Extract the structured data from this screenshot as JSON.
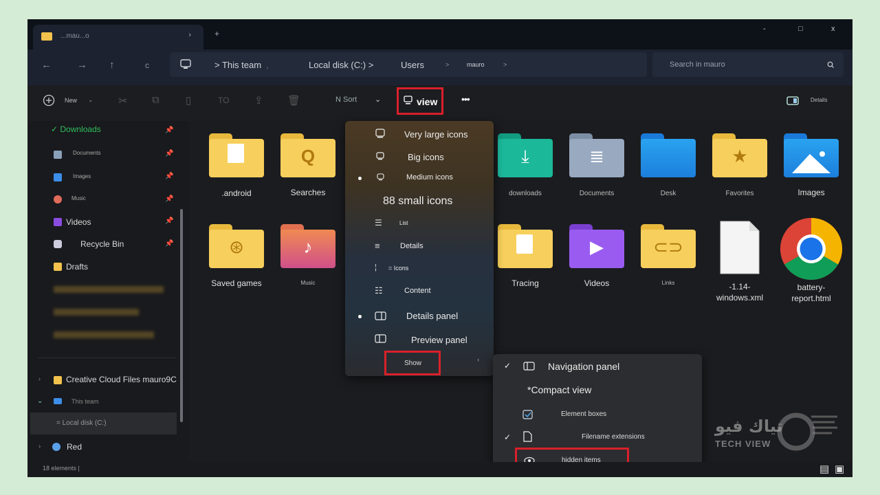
{
  "window": {
    "tab_title": "...mau...o",
    "new_tab": "+",
    "minimize": "-",
    "maximize": "□",
    "close": "x"
  },
  "nav": {
    "back": "←",
    "forward": "→",
    "up": "↑",
    "refresh": "c"
  },
  "address": {
    "crumbs": [
      "> This team",
      "Local disk (C:) >",
      "Users",
      "mauro"
    ],
    "separators": [
      ",",
      ">",
      ">"
    ]
  },
  "search": {
    "placeholder": "Search in mauro"
  },
  "toolbar": {
    "new_label": "New",
    "sort_label": "N Sort",
    "view_label": "view",
    "more_label": "•••",
    "details_label": "Details",
    "to_label": "TO"
  },
  "sidebar": {
    "items": [
      {
        "label": "✓ Downloads",
        "pinned": true
      },
      {
        "label": "Documents",
        "pinned": true
      },
      {
        "label": "Images",
        "pinned": true
      },
      {
        "label": "Music",
        "pinned": true
      },
      {
        "label": "Videos",
        "pinned": true
      },
      {
        "label": "Recycle Bin",
        "pinned": true
      },
      {
        "label": "Drafts",
        "pinned": false
      }
    ],
    "cloud": "Creative Cloud Files  mauro9C",
    "this_team": "This team",
    "local_disk": "= Local disk (C:)",
    "red": "Red"
  },
  "status": {
    "count": "18 elements |"
  },
  "files": [
    {
      "name": ".android"
    },
    {
      "name": "Searches"
    },
    {
      "name": "downloads"
    },
    {
      "name": "Documents"
    },
    {
      "name": "Desk"
    },
    {
      "name": "Favorites"
    },
    {
      "name": "Images"
    },
    {
      "name": "Saved games"
    },
    {
      "name": "Music"
    },
    {
      "name": "Tracing"
    },
    {
      "name": "Videos"
    },
    {
      "name": "Links"
    },
    {
      "name": "-1.14-windows.xml"
    },
    {
      "name": "battery-report.html"
    }
  ],
  "view_menu": {
    "items": [
      {
        "label": "Very large icons",
        "selected": false
      },
      {
        "label": "Big icons",
        "selected": false
      },
      {
        "label": "Medium icons",
        "selected": true
      },
      {
        "label": "88 small icons",
        "selected": false
      },
      {
        "label": "List",
        "selected": false
      },
      {
        "label": "Details",
        "selected": false
      },
      {
        "label": "= Icons",
        "selected": false
      },
      {
        "label": "Content",
        "selected": false
      },
      {
        "label": "Details panel",
        "selected": true
      },
      {
        "label": "Preview panel",
        "selected": false
      }
    ],
    "show_label": "Show"
  },
  "show_submenu": {
    "items": [
      {
        "label": "Navigation panel",
        "checked": true
      },
      {
        "label": "*Compact view",
        "checked": false
      },
      {
        "label": "Element boxes",
        "checked": false
      },
      {
        "label": "Filename extensions",
        "checked": true
      },
      {
        "label": "hidden items",
        "checked": false
      }
    ]
  },
  "watermark": {
    "arabic": "تياك فيو",
    "latin": "TECH VIEW"
  },
  "colors": {
    "accent_red": "#d9202a",
    "folder_yellow": "#f2c24d",
    "chrome_blue": "#1a73e8"
  }
}
